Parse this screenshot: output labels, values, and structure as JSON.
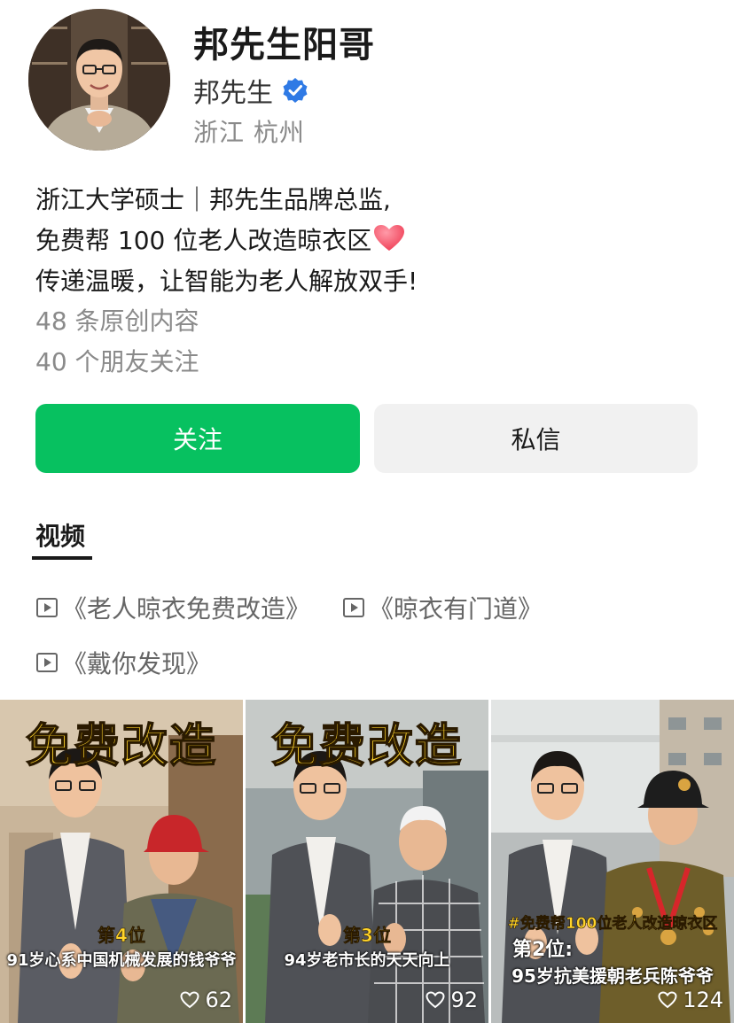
{
  "profile": {
    "display_name": "邦先生阳哥",
    "brand": "邦先生",
    "location": "浙江 杭州",
    "verified_icon": "verified-badge-icon"
  },
  "bio": {
    "line1": "浙江大学硕士｜邦先生品牌总监,",
    "line2": "免费帮 100 位老人改造晾衣区",
    "line3": "传递温暖，让智能为老人解放双手!",
    "original_count": "48 条原创内容",
    "friends_following": "40 个朋友关注"
  },
  "actions": {
    "follow_label": "关注",
    "message_label": "私信",
    "follow_color": "#07c160"
  },
  "tabs": {
    "active": "视频"
  },
  "collections": [
    {
      "label": "《老人晾衣免费改造》"
    },
    {
      "label": "《晾衣有门道》"
    },
    {
      "label": "《戴你发现》"
    }
  ],
  "videos": [
    {
      "title": "免费改造",
      "rank": "第4位",
      "caption": "91岁心系中国机械发展的钱爷爷",
      "likes": "62"
    },
    {
      "title": "免费改造",
      "rank": "第3位",
      "caption": "94岁老市长的天天向上",
      "likes": "92"
    },
    {
      "title": "",
      "hashtag": "#免费帮100位老人改造晾衣区",
      "rank": "第2位:",
      "caption": "95岁抗美援朝老兵陈爷爷",
      "likes": "124"
    }
  ]
}
